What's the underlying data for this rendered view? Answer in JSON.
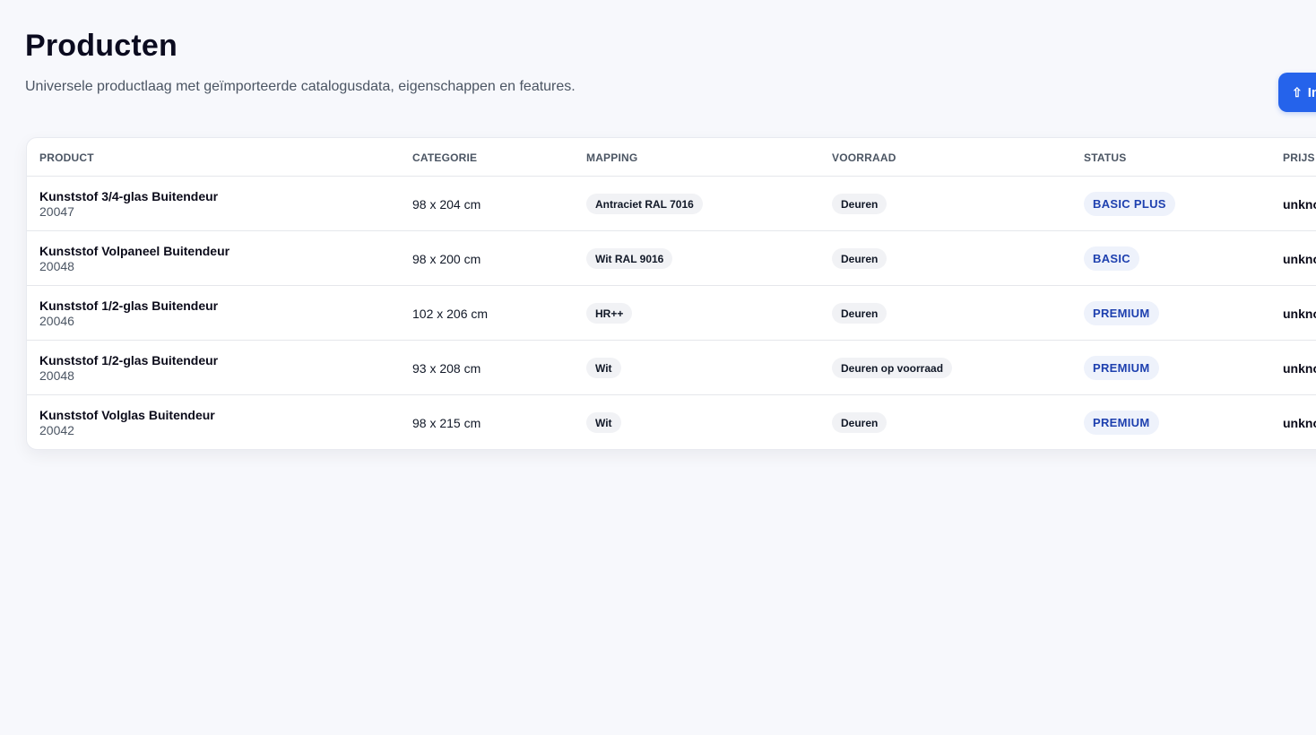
{
  "header": {
    "title": "Producten",
    "subtitle": "Universele productlaag met geïmporteerde catalogusdata, eigenschappen en features.",
    "import_button_icon": "upload-arrow-icon",
    "import_button_icon_glyph": "⇧",
    "import_button_label": "Importeren"
  },
  "colors": {
    "accent": "#2563eb",
    "badge_text": "#1e40af",
    "badge_bg": "#eef2fb",
    "background": "#f7f8fc"
  },
  "table": {
    "columns": [
      "PRODUCT",
      "CATEGORIE",
      "MAPPING",
      "VOORRAAD",
      "STATUS",
      "PRIJS"
    ],
    "rows": [
      {
        "name": "Kunststof 3/4-glas Buitendeur",
        "sku": "20047",
        "category": "98 x 204 cm",
        "mapping": "Antraciet RAL 7016",
        "stock": "Deuren",
        "status": "BASIC PLUS",
        "price": "unknown"
      },
      {
        "name": "Kunststof Volpaneel Buitendeur",
        "sku": "20048",
        "category": "98 x 200 cm",
        "mapping": "Wit RAL 9016",
        "stock": "Deuren",
        "status": "BASIC",
        "price": "unknown"
      },
      {
        "name": "Kunststof 1/2-glas Buitendeur",
        "sku": "20046",
        "category": "102 x 206 cm",
        "mapping": "HR++",
        "stock": "Deuren",
        "status": "PREMIUM",
        "price": "unknown"
      },
      {
        "name": "Kunststof 1/2-glas Buitendeur",
        "sku": "20048",
        "category": "93 x 208 cm",
        "mapping": "Wit",
        "stock": "Deuren op voorraad",
        "status": "PREMIUM",
        "price": "unknown"
      },
      {
        "name": "Kunststof Volglas Buitendeur",
        "sku": "20042",
        "category": "98 x 215 cm",
        "mapping": "Wit",
        "stock": "Deuren",
        "status": "PREMIUM",
        "price": "unknown"
      }
    ]
  }
}
